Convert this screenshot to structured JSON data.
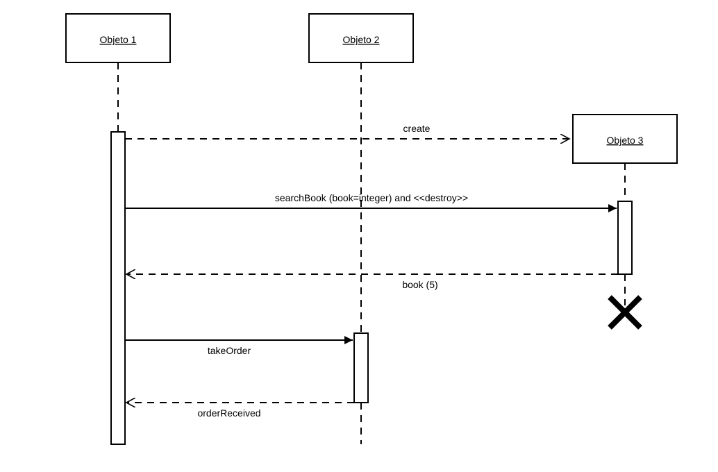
{
  "lifelines": {
    "obj1": "Objeto 1",
    "obj2": "Objeto 2",
    "obj3": "Objeto 3"
  },
  "messages": {
    "create": "create",
    "searchBook": "searchBook (book=integer) and <<destroy>>",
    "book": "book (5)",
    "takeOrder": "takeOrder",
    "orderReceived": "orderReceived"
  }
}
